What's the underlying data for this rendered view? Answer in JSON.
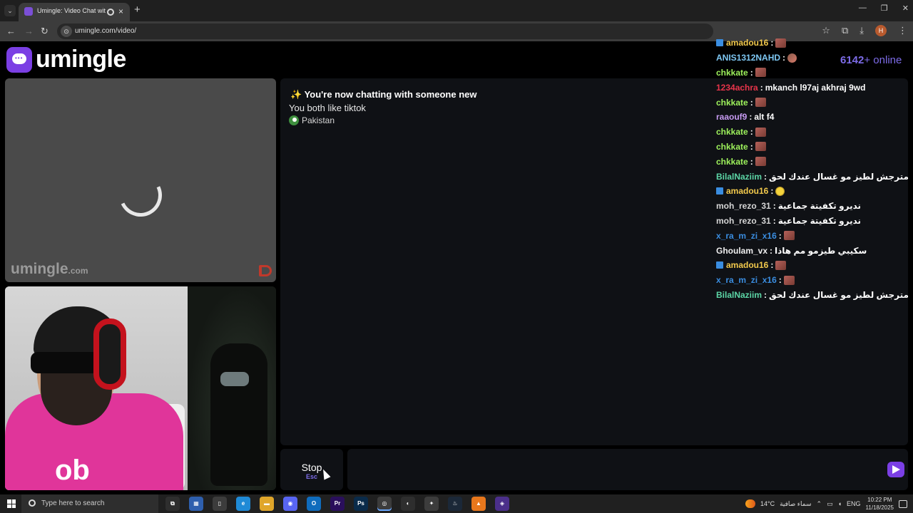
{
  "browser": {
    "tab_title": "Umingle: Video Chat with S",
    "url": "umingle.com/video/",
    "new_tab": "+",
    "profile_initial": "H",
    "window_minimize": "—",
    "window_restore": "❐",
    "window_close": "✕"
  },
  "site": {
    "logo_text": "umingle",
    "online_count": "6142",
    "online_suffix": "+ online",
    "watermark": "umingle",
    "watermark_domain": ".com"
  },
  "chat": {
    "system_message": "You're now chatting with someone new",
    "sparkle": "✨",
    "common_interest": "You both like tiktok",
    "country": "Pakistan",
    "stop_label": "Stop",
    "stop_key": "Esc",
    "input_placeholder": ""
  },
  "overlay_chat": [
    {
      "user": "amadou16",
      "color": "#f2c94c",
      "twitch_badge": true,
      "emote": "emote",
      "text": ""
    },
    {
      "user": "ANIS1312NAHD",
      "color": "#7ec8f4",
      "twitch_badge": false,
      "emote": "cam",
      "text": ""
    },
    {
      "user": "chkkate",
      "color": "#9ef25c",
      "twitch_badge": false,
      "emote": "emote",
      "text": ""
    },
    {
      "user": "1234achra",
      "color": "#e8344a",
      "twitch_badge": false,
      "emote": "",
      "text": "mkanch l97aj akhraj 9wd"
    },
    {
      "user": "chkkate",
      "color": "#9ef25c",
      "twitch_badge": false,
      "emote": "emote",
      "text": ""
    },
    {
      "user": "raaouf9",
      "color": "#c79bf2",
      "twitch_badge": false,
      "emote": "",
      "text": "alt f4"
    },
    {
      "user": "chkkate",
      "color": "#9ef25c",
      "twitch_badge": false,
      "emote": "emote",
      "text": ""
    },
    {
      "user": "chkkate",
      "color": "#9ef25c",
      "twitch_badge": false,
      "emote": "emote",
      "text": ""
    },
    {
      "user": "chkkate",
      "color": "#9ef25c",
      "twitch_badge": false,
      "emote": "emote",
      "text": ""
    },
    {
      "user": "BilalNaziim",
      "color": "#5cd6a6",
      "twitch_badge": false,
      "emote": "",
      "text": "مترجش لطيز مو غسال عندك لحق"
    },
    {
      "user": "amadou16",
      "color": "#f2c94c",
      "twitch_badge": true,
      "emote": "face",
      "text": ""
    },
    {
      "user": "moh_rezo_31",
      "color": "#d6d6d6",
      "twitch_badge": false,
      "emote": "",
      "text": "نديرو تكفيتة جماعية"
    },
    {
      "user": "moh_rezo_31",
      "color": "#d6d6d6",
      "twitch_badge": false,
      "emote": "",
      "text": "نديرو تكفيتة جماعية"
    },
    {
      "user": "x_ra_m_zi_x16",
      "color": "#3a8de0",
      "twitch_badge": false,
      "emote": "emote",
      "text": ""
    },
    {
      "user": "Ghoulam_vx",
      "color": "#f0f0f0",
      "twitch_badge": false,
      "emote": "",
      "text": "سكيبي طيزمو مم هاذا"
    },
    {
      "user": "amadou16",
      "color": "#f2c94c",
      "twitch_badge": true,
      "emote": "emote",
      "text": ""
    },
    {
      "user": "x_ra_m_zi_x16",
      "color": "#3a8de0",
      "twitch_badge": false,
      "emote": "emote",
      "text": ""
    },
    {
      "user": "BilalNaziim",
      "color": "#5cd6a6",
      "twitch_badge": false,
      "emote": "",
      "text": "مترجش لطيز مو غسال عندك لحق"
    }
  ],
  "taskbar": {
    "search_placeholder": "Type here to search",
    "weather_temp": "14°C",
    "weather_text": "سماء صافية",
    "language": "ENG",
    "time": "10:22 PM",
    "date": "11/18/2025",
    "apps": [
      {
        "name": "task-view",
        "label": "⧉",
        "color": "#2e2e2e"
      },
      {
        "name": "microsoft-store",
        "label": "▦",
        "color": "#2e5fae"
      },
      {
        "name": "notepad",
        "label": "▯",
        "color": "#3c3c3c"
      },
      {
        "name": "edge",
        "label": "e",
        "color": "#1f8ad6"
      },
      {
        "name": "file-explorer",
        "label": "▬",
        "color": "#e0a62a"
      },
      {
        "name": "discord",
        "label": "◉",
        "color": "#5865f2"
      },
      {
        "name": "outlook",
        "label": "O",
        "color": "#0f6cbd"
      },
      {
        "name": "premiere-pro",
        "label": "Pr",
        "color": "#2a0f5c"
      },
      {
        "name": "photoshop",
        "label": "Ps",
        "color": "#0a2b4a"
      },
      {
        "name": "chrome",
        "label": "◎",
        "color": "#3c3c3c"
      },
      {
        "name": "obs",
        "label": "◐",
        "color": "#2e2e2e"
      },
      {
        "name": "fl-studio",
        "label": "✦",
        "color": "#3c3c3c"
      },
      {
        "name": "steam",
        "label": "♨",
        "color": "#1b2838"
      },
      {
        "name": "vlc-app",
        "label": "▲",
        "color": "#e8771c"
      },
      {
        "name": "twitch-app",
        "label": "◈",
        "color": "#4b2f8a"
      }
    ]
  },
  "colors": {
    "brand": "#7b3fe4",
    "online": "#7d6ce8",
    "panel": "#0f1115"
  }
}
